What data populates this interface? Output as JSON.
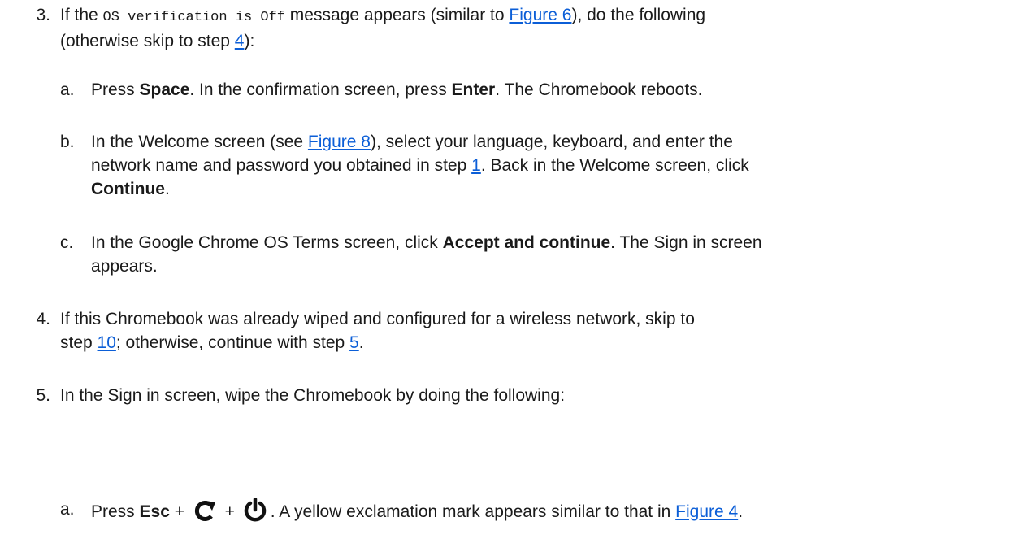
{
  "items": {
    "s3": {
      "num": "3.",
      "t1": "If the ",
      "code": "OS verification is Off",
      "t2": " message appears (similar to ",
      "link_fig6": "Figure 6",
      "t3": "), do the following",
      "t4": "(otherwise skip to step ",
      "link_step4": "4",
      "t5": "):"
    },
    "s3a": {
      "letter": "a.",
      "t1": "Press ",
      "b1": "Space",
      "t2": ". In the confirmation screen, press ",
      "b2": "Enter",
      "t3": ". The Chromebook reboots."
    },
    "s3b": {
      "letter": "b.",
      "t1": "In the Welcome screen (see ",
      "link_fig8": "Figure 8",
      "t2": "), select your language, keyboard, and enter the",
      "t3": "network name and password you obtained in step ",
      "link_step1": "1",
      "t4": ". Back in the Welcome screen, click",
      "b1": "Continue",
      "t5": "."
    },
    "s3c": {
      "letter": "c.",
      "t1": "In the Google Chrome OS Terms screen, click ",
      "b1": "Accept and continue",
      "t2": ". The Sign in screen",
      "t3": "appears."
    },
    "s4": {
      "num": "4.",
      "t1": "If this Chromebook was already wiped and configured for a wireless network, skip to",
      "t2": "step ",
      "link_step10": "10",
      "t3": "; otherwise, continue with step ",
      "link_step5": "5",
      "t4": "."
    },
    "s5": {
      "num": "5.",
      "t1": "In the Sign in screen, wipe the Chromebook by doing the following:"
    },
    "s5a": {
      "letter": "a.",
      "t1": "Press ",
      "b1": "Esc",
      "plus": " + ",
      "t2": ". A yellow exclamation mark appears similar to that in ",
      "link_fig4": "Figure 4",
      "t3": "."
    }
  },
  "icons": {
    "refresh": "refresh-icon",
    "power": "power-icon"
  }
}
